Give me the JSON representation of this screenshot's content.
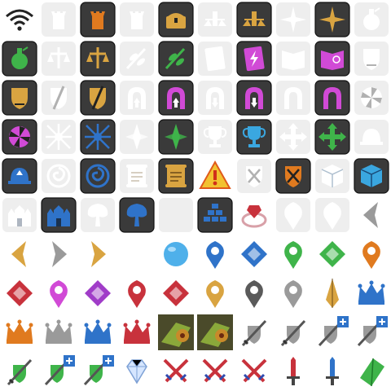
{
  "sheet": {
    "type": "game-icon-sprite-sheet",
    "columns": 10,
    "rows": 10,
    "palette": {
      "tile_dark": "#3a3a3a",
      "tile_faded": "#d0d0d0",
      "orange": "#e07a1f",
      "gold": "#d9a441",
      "purple": "#a03cc8",
      "magenta": "#d14ad6",
      "green": "#3fb44a",
      "blue": "#2f73c9",
      "cyan": "#3aa7e0",
      "red": "#c8323c",
      "warning_yellow": "#f2c230",
      "silver": "#9a9a9a"
    },
    "icons": [
      {
        "name": "wifi-icon",
        "style": "plain"
      },
      {
        "name": "tower-icon",
        "style": "faded"
      },
      {
        "name": "tower-icon",
        "style": "tile-orange"
      },
      {
        "name": "tower-icon",
        "style": "faded"
      },
      {
        "name": "treasure-chest-icon",
        "style": "tile-gold"
      },
      {
        "name": "balance-tower-icon",
        "style": "faded"
      },
      {
        "name": "balance-tower-icon",
        "style": "tile-gold"
      },
      {
        "name": "compass-star-icon",
        "style": "faded"
      },
      {
        "name": "compass-star-icon",
        "style": "tile-gold"
      },
      {
        "name": "potion-icon",
        "style": "faded"
      },
      {
        "name": "potion-icon",
        "style": "tile-green"
      },
      {
        "name": "scales-hands-icon",
        "style": "faded"
      },
      {
        "name": "scales-hands-icon",
        "style": "tile-gold"
      },
      {
        "name": "leaf-branch-icon",
        "style": "faded"
      },
      {
        "name": "leaf-branch-icon",
        "style": "tile-green"
      },
      {
        "name": "lightning-card-icon",
        "style": "faded"
      },
      {
        "name": "lightning-card-icon",
        "style": "tile-magenta"
      },
      {
        "name": "spellbook-icon",
        "style": "faded"
      },
      {
        "name": "spellbook-icon",
        "style": "tile-magenta"
      },
      {
        "name": "shield-scales-icon",
        "style": "faded"
      },
      {
        "name": "shield-scales-icon",
        "style": "tile-gold"
      },
      {
        "name": "broken-shield-icon",
        "style": "faded"
      },
      {
        "name": "broken-shield-icon",
        "style": "tile-gold"
      },
      {
        "name": "arch-up-icon",
        "style": "faded"
      },
      {
        "name": "arch-up-icon",
        "style": "tile-magenta"
      },
      {
        "name": "arch-down-icon",
        "style": "faded"
      },
      {
        "name": "arch-down-icon",
        "style": "tile-magenta"
      },
      {
        "name": "arch-icon",
        "style": "faded"
      },
      {
        "name": "arch-icon",
        "style": "tile-magenta"
      },
      {
        "name": "radial-icon",
        "style": "faded"
      },
      {
        "name": "radial-icon",
        "style": "tile-magenta"
      },
      {
        "name": "vortex-icon",
        "style": "faded"
      },
      {
        "name": "vortex-icon",
        "style": "tile-blue"
      },
      {
        "name": "crystal-burst-icon",
        "style": "faded"
      },
      {
        "name": "crystal-burst-icon",
        "style": "tile-green"
      },
      {
        "name": "trophy-icon",
        "style": "faded"
      },
      {
        "name": "trophy-icon",
        "style": "tile-cyan"
      },
      {
        "name": "move-arrows-icon",
        "style": "faded"
      },
      {
        "name": "move-arrows-icon",
        "style": "tile-green"
      },
      {
        "name": "dome-icon",
        "style": "faded"
      },
      {
        "name": "dome-icon",
        "style": "tile-blue"
      },
      {
        "name": "spiral-icon",
        "style": "faded"
      },
      {
        "name": "spiral-icon",
        "style": "tile-blue"
      },
      {
        "name": "scroll-icon",
        "style": "faded"
      },
      {
        "name": "scroll-icon",
        "style": "tile-gold"
      },
      {
        "name": "warning-icon",
        "style": "plain"
      },
      {
        "name": "crossed-shield-icon",
        "style": "faded"
      },
      {
        "name": "crossed-shield-icon",
        "style": "tile-orange"
      },
      {
        "name": "cube-icon",
        "style": "faded"
      },
      {
        "name": "cube-icon",
        "style": "tile-cyan"
      },
      {
        "name": "castle-icon",
        "style": "faded"
      },
      {
        "name": "castle-icon",
        "style": "tile-blue"
      },
      {
        "name": "tree-icon",
        "style": "faded"
      },
      {
        "name": "tree-icon",
        "style": "tile-blue"
      },
      {
        "name": "blank-tile-icon",
        "style": "faded"
      },
      {
        "name": "pyramid-blocks-icon",
        "style": "tile-blue"
      },
      {
        "name": "ruby-ring-icon",
        "style": "plain"
      },
      {
        "name": "map-pin-icon",
        "style": "faded"
      },
      {
        "name": "map-pin-icon",
        "style": "faded"
      },
      {
        "name": "chevron-left-icon",
        "style": "plain-silver"
      },
      {
        "name": "chevron-left-icon",
        "style": "plain-gold"
      },
      {
        "name": "chevron-right-icon",
        "style": "plain-silver"
      },
      {
        "name": "chevron-right-icon",
        "style": "plain-gold"
      },
      {
        "name": "blank-icon",
        "style": "plain"
      },
      {
        "name": "blue-orb-icon",
        "style": "plain"
      },
      {
        "name": "map-pin-icon",
        "style": "plain-blue"
      },
      {
        "name": "diamond-marker-icon",
        "style": "plain-blue"
      },
      {
        "name": "map-pin-icon",
        "style": "plain-green"
      },
      {
        "name": "diamond-marker-icon",
        "style": "plain-green"
      },
      {
        "name": "map-pin-icon",
        "style": "plain-orange"
      },
      {
        "name": "diamond-marker-icon",
        "style": "plain-red"
      },
      {
        "name": "map-pin-icon",
        "style": "plain-magenta"
      },
      {
        "name": "diamond-marker-icon",
        "style": "plain-purple"
      },
      {
        "name": "map-pin-icon",
        "style": "plain-red"
      },
      {
        "name": "diamond-marker-icon",
        "style": "plain-red"
      },
      {
        "name": "map-pin-icon",
        "style": "plain-gold"
      },
      {
        "name": "map-pin-icon",
        "style": "plain-dark"
      },
      {
        "name": "map-pin-icon",
        "style": "plain-silver"
      },
      {
        "name": "spike-pin-icon",
        "style": "plain-gold"
      },
      {
        "name": "crown-icon",
        "style": "plain-blue"
      },
      {
        "name": "crown-icon",
        "style": "plain-orange"
      },
      {
        "name": "crown-icon",
        "style": "plain-silver"
      },
      {
        "name": "crown-icon",
        "style": "plain-blue"
      },
      {
        "name": "crown-icon",
        "style": "plain-red"
      },
      {
        "name": "chest-artwork-icon",
        "style": "photo"
      },
      {
        "name": "chest-artwork-icon",
        "style": "photo"
      },
      {
        "name": "sword-shield-icon",
        "style": "plain-silver"
      },
      {
        "name": "sword-shield-icon",
        "style": "plain-silver"
      },
      {
        "name": "sword-shield-plus-icon",
        "style": "plain-silver"
      },
      {
        "name": "sword-shield-plus-icon",
        "style": "plain-silver"
      },
      {
        "name": "sword-shield-icon",
        "style": "plain-green"
      },
      {
        "name": "sword-shield-plus-icon",
        "style": "plain-green"
      },
      {
        "name": "sword-shield-plus-icon",
        "style": "plain-green"
      },
      {
        "name": "diamond-gem-icon",
        "style": "plain"
      },
      {
        "name": "crossed-swords-icon",
        "style": "plain-red"
      },
      {
        "name": "crossed-swords-icon",
        "style": "plain-red"
      },
      {
        "name": "crossed-swords-icon",
        "style": "plain-red"
      },
      {
        "name": "sword-icon",
        "style": "plain-red"
      },
      {
        "name": "sword-icon",
        "style": "plain-blue"
      },
      {
        "name": "green-crystal-icon",
        "style": "plain"
      }
    ]
  }
}
